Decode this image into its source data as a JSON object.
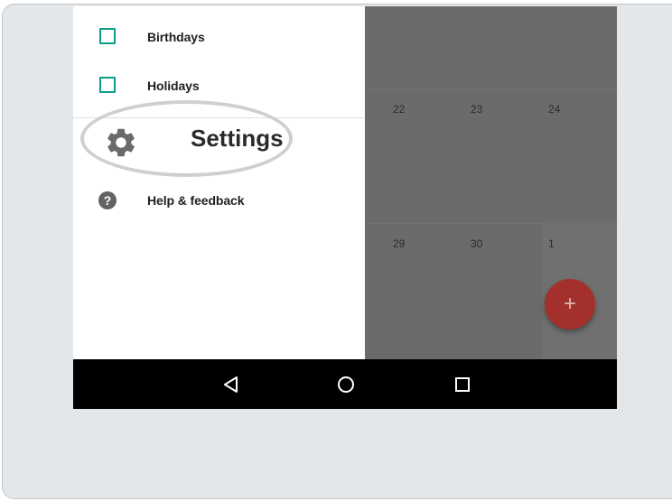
{
  "drawer": {
    "calendars": [
      {
        "label": "Birthdays",
        "checked": false
      },
      {
        "label": "Holidays",
        "checked": false
      }
    ],
    "settings": {
      "label": "Settings",
      "icon": "gear-icon",
      "highlighted": true
    },
    "help": {
      "label": "Help & feedback",
      "icon": "help-icon",
      "glyph": "?"
    }
  },
  "calendar": {
    "week1": [
      "22",
      "23",
      "24"
    ],
    "week2": [
      "29",
      "30",
      "1"
    ]
  },
  "fab": {
    "glyph": "+",
    "icon": "add-icon",
    "color": "#a3302b"
  },
  "nav_bar": {
    "buttons": [
      "back-icon",
      "home-icon",
      "recents-icon"
    ]
  },
  "colors": {
    "checkbox": "#0c9c8a",
    "scrim": "#6b6b6b",
    "nav_bar": "#000000"
  }
}
